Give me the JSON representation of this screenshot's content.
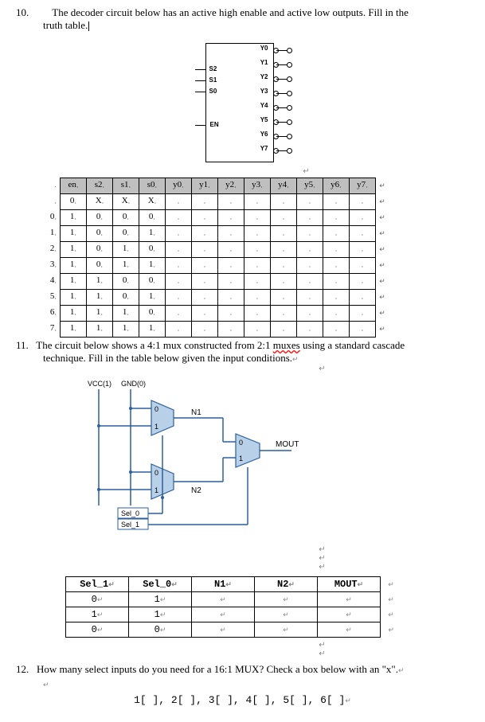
{
  "q10": {
    "number": "10.",
    "text_a": "The decoder circuit below has an active high enable and active low outputs. Fill in the",
    "text_b": "truth table."
  },
  "decoder": {
    "inputs": [
      "S2",
      "S1",
      "S0"
    ],
    "en": "EN",
    "outputs": [
      "Y0",
      "Y1",
      "Y2",
      "Y3",
      "Y4",
      "Y5",
      "Y6",
      "Y7"
    ]
  },
  "truth": {
    "headers": [
      "en",
      "s2",
      "s1",
      "s0",
      "y0",
      "y1",
      "y2",
      "y3",
      "y4",
      "y5",
      "y6",
      "y7"
    ],
    "row_labels": [
      "",
      "0",
      "1",
      "2",
      "3",
      "4",
      "5",
      "6",
      "7"
    ],
    "data": [
      [
        "0",
        "X",
        "X",
        "X",
        "",
        "",
        "",
        "",
        "",
        "",
        "",
        ""
      ],
      [
        "1",
        "0",
        "0",
        "0",
        "",
        "",
        "",
        "",
        "",
        "",
        "",
        ""
      ],
      [
        "1",
        "0",
        "0",
        "1",
        "",
        "",
        "",
        "",
        "",
        "",
        "",
        ""
      ],
      [
        "1",
        "0",
        "1",
        "0",
        "",
        "",
        "",
        "",
        "",
        "",
        "",
        ""
      ],
      [
        "1",
        "0",
        "1",
        "1",
        "",
        "",
        "",
        "",
        "",
        "",
        "",
        ""
      ],
      [
        "1",
        "1",
        "0",
        "0",
        "",
        "",
        "",
        "",
        "",
        "",
        "",
        ""
      ],
      [
        "1",
        "1",
        "0",
        "1",
        "",
        "",
        "",
        "",
        "",
        "",
        "",
        ""
      ],
      [
        "1",
        "1",
        "1",
        "0",
        "",
        "",
        "",
        "",
        "",
        "",
        "",
        ""
      ],
      [
        "1",
        "1",
        "1",
        "1",
        "",
        "",
        "",
        "",
        "",
        "",
        "",
        ""
      ]
    ]
  },
  "q11": {
    "number": "11.",
    "text_a": "The circuit below shows a 4:1 mux constructed from 2:1 ",
    "text_u": "muxes",
    "text_b": " using a standard cascade",
    "text_c": "technique. Fill in the table below given the input conditions."
  },
  "mux_diagram": {
    "vcc": "VCC(1)",
    "gnd": "GND(0)",
    "n1": "N1",
    "n2": "N2",
    "mout": "MOUT",
    "sel0": "Sel_0",
    "sel1": "Sel_1",
    "port0": "0",
    "port1": "1"
  },
  "mux_table": {
    "headers": [
      "Sel_1",
      "Sel_0",
      "N1",
      "N2",
      "MOUT"
    ],
    "rows": [
      [
        "0",
        "1",
        "",
        "",
        ""
      ],
      [
        "1",
        "1",
        "",
        "",
        ""
      ],
      [
        "0",
        "0",
        "",
        "",
        ""
      ]
    ]
  },
  "q12": {
    "number": "12.",
    "text": "How many select inputs do you need for a 16:1 MUX? Check a box below with an \"x\".",
    "choices": "1[ ], 2[ ], 3[ ], 4[ ], 5[ ], 6[ ]"
  },
  "glyphs": {
    "para": "↵",
    "dot": "·"
  }
}
